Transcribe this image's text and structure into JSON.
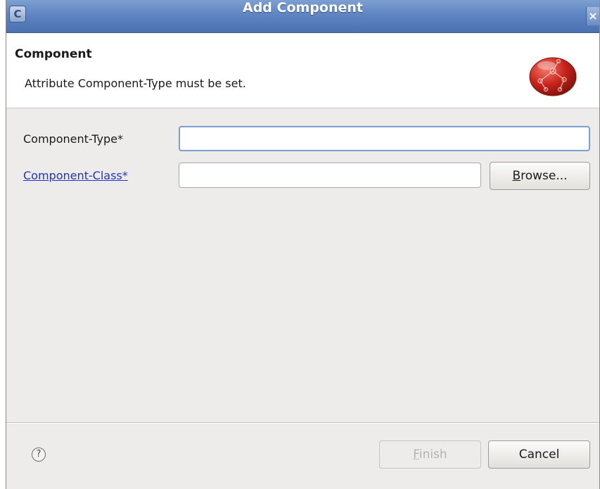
{
  "window": {
    "title": "Add Component",
    "close_glyph": "×",
    "app_icon": "eclipse-app-icon",
    "app_icon_glyph": "C"
  },
  "banner": {
    "title": "Component",
    "message": "Attribute Component-Type must be set.",
    "logo_icon": "red-component-sphere-icon"
  },
  "form": {
    "component_type": {
      "label": "Component-Type*",
      "value": ""
    },
    "component_class": {
      "label": "Component-Class*",
      "value": ""
    },
    "browse_button": {
      "mnemonic": "B",
      "rest": "rowse..."
    }
  },
  "footer": {
    "help_glyph": "?",
    "finish_button": {
      "mnemonic": "F",
      "rest": "inish",
      "enabled": false
    },
    "cancel_button": {
      "label": "Cancel"
    }
  },
  "colors": {
    "titlebar": "#5f85c2",
    "dialog_bg": "#edeceb",
    "link": "#1f35c8",
    "focus_border": "#7c9fd0",
    "logo_red": "#c8241b"
  }
}
